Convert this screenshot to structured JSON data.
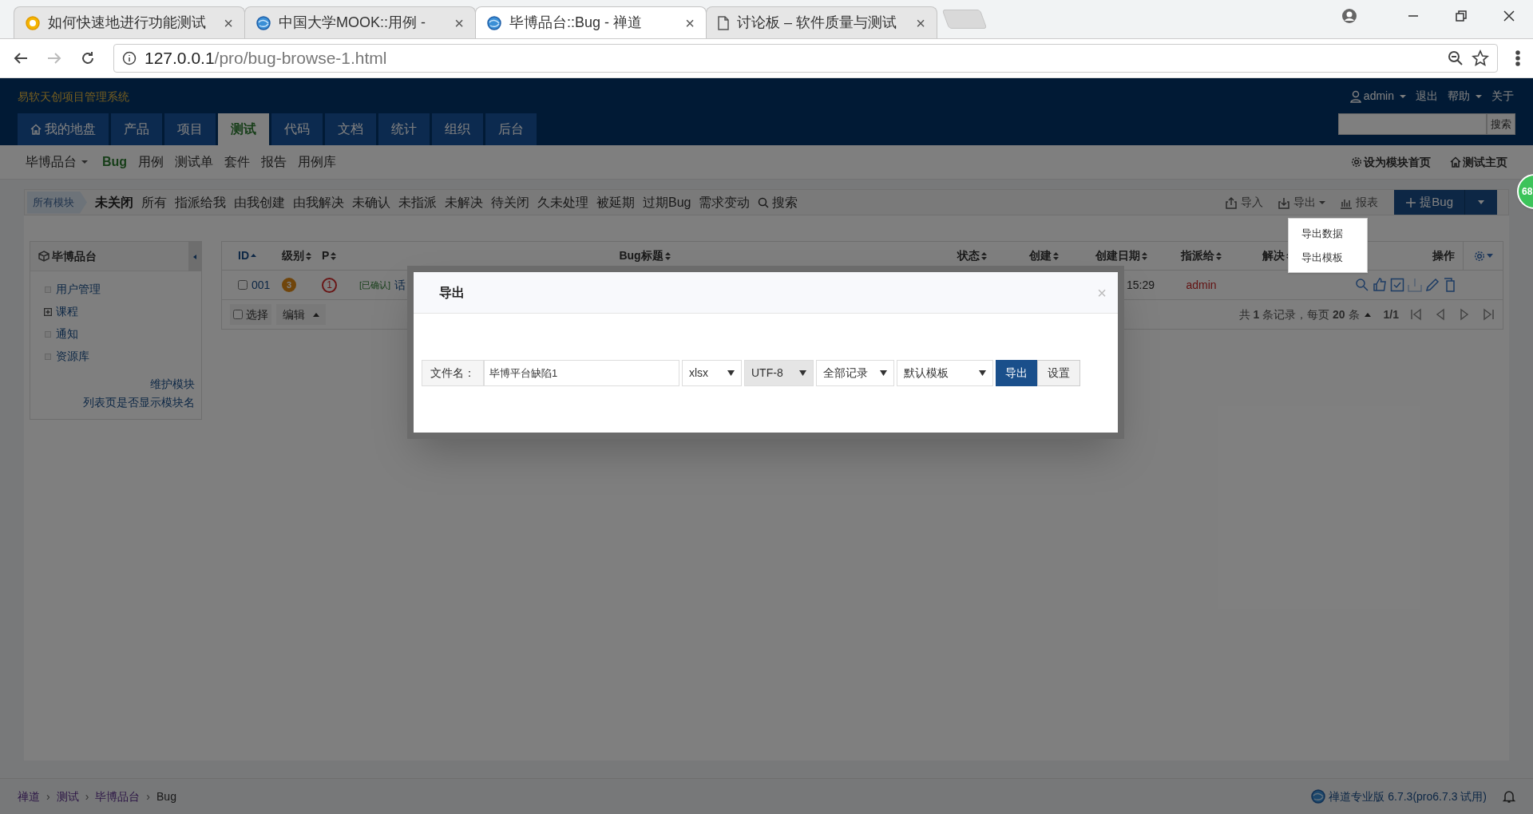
{
  "browser": {
    "tabs": [
      {
        "title": "如何快速地进行功能测试",
        "kind": "badge",
        "close": "×",
        "selected": false
      },
      {
        "title": "中国大学MOOK::用例 -",
        "kind": "globe",
        "close": "×",
        "selected": false
      },
      {
        "title": "毕博品台::Bug - 禅道",
        "kind": "globe",
        "close": "×",
        "selected": true
      },
      {
        "title": "讨论板 – 软件质量与测试",
        "kind": "page",
        "close": "×",
        "selected": false
      }
    ],
    "url": {
      "host": "127.0.0.1",
      "path": "/pro/bug-browse-1.html"
    }
  },
  "header": {
    "app_title": "易软天创项目管理系统",
    "user_menu": [
      {
        "label": "admin",
        "kind": "user"
      },
      {
        "label": "退出",
        "kind": "link"
      },
      {
        "label": "帮助",
        "kind": "menu"
      },
      {
        "label": "关于",
        "kind": "link"
      }
    ],
    "search_button": "搜索",
    "nav": [
      {
        "label": "我的地盘",
        "selected": false,
        "kind": "home"
      },
      {
        "label": "产品",
        "selected": false
      },
      {
        "label": "项目",
        "selected": false
      },
      {
        "label": "测试",
        "selected": true
      },
      {
        "label": "代码",
        "selected": false
      },
      {
        "label": "文档",
        "selected": false
      },
      {
        "label": "统计",
        "selected": false
      },
      {
        "label": "组织",
        "selected": false
      },
      {
        "label": "后台",
        "selected": false
      }
    ]
  },
  "subnav": {
    "product": "毕博品台",
    "items": [
      {
        "label": "Bug",
        "selected": true
      },
      {
        "label": "用例",
        "selected": false
      },
      {
        "label": "测试单",
        "selected": false
      },
      {
        "label": "套件",
        "selected": false
      },
      {
        "label": "报告",
        "selected": false
      },
      {
        "label": "用例库",
        "selected": false
      }
    ],
    "right": [
      {
        "label": "设为模块首页",
        "kind": "gear"
      },
      {
        "label": "测试主页",
        "kind": "home"
      }
    ]
  },
  "filter_bar": {
    "module": "所有模块",
    "filters": [
      {
        "label": "未关闭",
        "selected": true
      },
      {
        "label": "所有",
        "selected": false
      },
      {
        "label": "指派给我",
        "selected": false
      },
      {
        "label": "由我创建",
        "selected": false
      },
      {
        "label": "由我解决",
        "selected": false
      },
      {
        "label": "未确认",
        "selected": false
      },
      {
        "label": "未指派",
        "selected": false
      },
      {
        "label": "未解决",
        "selected": false
      },
      {
        "label": "待关闭",
        "selected": false
      },
      {
        "label": "久未处理",
        "selected": false
      },
      {
        "label": "被延期",
        "selected": false
      },
      {
        "label": "过期Bug",
        "selected": false
      },
      {
        "label": "需求变动",
        "selected": false
      }
    ],
    "search": "搜索",
    "actions": [
      {
        "label": "导入",
        "kind": "upload"
      },
      {
        "label": "导出",
        "kind": "download",
        "expanded": true
      },
      {
        "label": "报表",
        "kind": "chart"
      }
    ],
    "create_button": "提Bug"
  },
  "export_menu": [
    "导出数据",
    "导出模板"
  ],
  "sidebar": {
    "title": "毕博品台",
    "items": [
      {
        "label": "用户管理",
        "expandable": false
      },
      {
        "label": "课程",
        "expandable": true
      },
      {
        "label": "通知",
        "expandable": false
      },
      {
        "label": "资源库",
        "expandable": false
      }
    ],
    "links": [
      "维护模块",
      "列表页是否显示模块名"
    ]
  },
  "table": {
    "columns": [
      "ID",
      "级别",
      "P",
      "Bug标题",
      "状态",
      "创建",
      "创建日期",
      "指派给",
      "解决",
      "操作"
    ],
    "rows": [
      {
        "checked": false,
        "id": "001",
        "severity": "3",
        "priority": "1",
        "title_tag": "[已确认]",
        "title": "话",
        "created_date": "15:29",
        "assigned_to": "admin"
      }
    ],
    "footer": {
      "select_all": "选择",
      "select_all_checked": false,
      "edit": "编辑",
      "summary": "共 **1** 条记录，每页 **20** 条",
      "page": "1/1"
    }
  },
  "modal": {
    "title": "导出",
    "close": "×",
    "file_label": "文件名：",
    "file_name": "毕博平台缺陷1",
    "format": "xlsx",
    "encoding": "UTF-8",
    "range": "全部记录",
    "template": "默认模板",
    "export_button": "导出",
    "settings_button": "设置"
  },
  "floating_badge": "68",
  "footer": {
    "separator": "›",
    "breadcrumb": [
      "禅道",
      "测试",
      "毕博品台",
      "Bug"
    ],
    "version": "禅道专业版 6.7.3(pro6.7.3 试用)"
  }
}
